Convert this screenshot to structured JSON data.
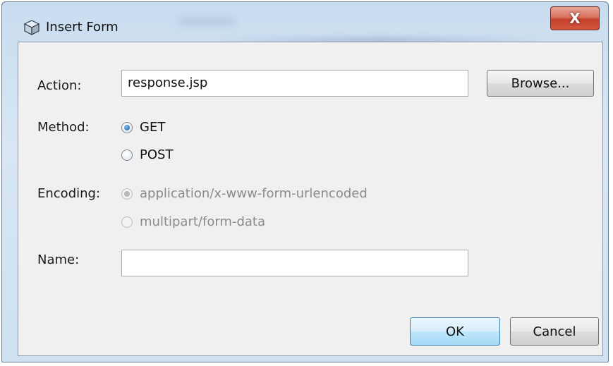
{
  "window": {
    "title": "Insert Form",
    "close_glyph": "X",
    "icon": "cube-icon"
  },
  "form": {
    "action_label": "Action:",
    "action_value": "response.jsp",
    "browse_label": "Browse...",
    "method_label": "Method:",
    "method_options": [
      {
        "label": "GET",
        "selected": true,
        "enabled": true
      },
      {
        "label": "POST",
        "selected": false,
        "enabled": true
      }
    ],
    "encoding_label": "Encoding:",
    "encoding_options": [
      {
        "label": "application/x-www-form-urlencoded",
        "selected": true,
        "enabled": false
      },
      {
        "label": "multipart/form-data",
        "selected": false,
        "enabled": false
      }
    ],
    "name_label": "Name:",
    "name_value": ""
  },
  "buttons": {
    "ok_label": "OK",
    "cancel_label": "Cancel"
  },
  "colors": {
    "frame": "#cfe0f0",
    "close_button": "#c4402c",
    "default_button": "#bee6fd"
  }
}
